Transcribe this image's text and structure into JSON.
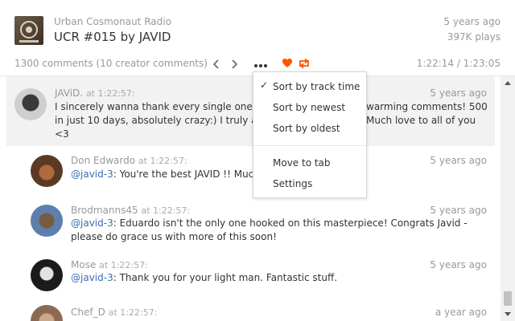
{
  "header": {
    "station": "Urban Cosmonaut Radio",
    "title": "UCR #015 by JAVID",
    "posted": "5 years ago",
    "plays": "397K plays"
  },
  "toolbar": {
    "comment_count": "1300 comments (10 creator comments)",
    "time_position": "1:22:14 / 1:23:05",
    "icons": [
      "chevron-left-icon",
      "chevron-right-icon",
      "more-icon",
      "heart-icon",
      "repost-icon"
    ],
    "accent_color": "#ff5500"
  },
  "menu": {
    "items": [
      {
        "label": "Sort by track time",
        "checked": true
      },
      {
        "label": "Sort by newest",
        "checked": false
      },
      {
        "label": "Sort by oldest",
        "checked": false
      },
      {
        "label": "Move to tab",
        "checked": false
      },
      {
        "label": "Settings",
        "checked": false
      }
    ]
  },
  "comments": [
    {
      "user": "JAViD.",
      "at": "at 1:22:57:",
      "time": "5 years ago",
      "text_line1": "I sincerely wanna thank every single one o",
      "text_line1b": "warming comments! 500",
      "text_line2": "in just 10 days, absolutely crazy:) I truly ap",
      "text_line2b": "Much love to all of you",
      "text_line3": "<3"
    },
    {
      "user": "Don Edwardo",
      "at": "at 1:22:57:",
      "time": "5 years ago",
      "mention": "@javid-3",
      "text": ": You're the best JAVID !! Much"
    },
    {
      "user": "Brodmanns45",
      "at": "at 1:22:57:",
      "time": "5 years ago",
      "mention": "@javid-3",
      "text": ": Eduardo isn't the only one hooked on this masterpiece! Congrats Javid -",
      "text2": "please do grace us with more of this soon!"
    },
    {
      "user": "Mose",
      "at": "at 1:22:57:",
      "time": "5 years ago",
      "mention": "@javid-3",
      "text": ": Thank you for your light man. Fantastic stuff."
    },
    {
      "user": "Chef_D",
      "at": "at 1:22:57:",
      "time": "a year ago"
    }
  ]
}
